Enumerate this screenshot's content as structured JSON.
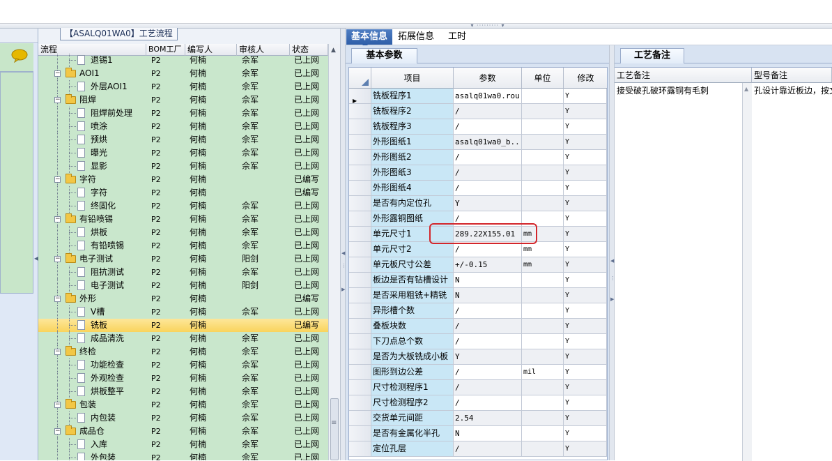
{
  "tree": {
    "title": "【ASALQ01WA0】工艺流程",
    "columns": [
      "流程",
      "BOM工厂",
      "编写人",
      "审核人",
      "状态"
    ],
    "rows": [
      {
        "name": "退锡1",
        "type": "doc",
        "level": 2,
        "bom": "P2",
        "writer": "何楠",
        "checker": "佘军",
        "status": "已上网"
      },
      {
        "name": "AOI1",
        "type": "folder",
        "level": 1,
        "bom": "P2",
        "writer": "何楠",
        "checker": "佘军",
        "status": "已上网"
      },
      {
        "name": "外层AOI1",
        "type": "doc",
        "level": 2,
        "bom": "P2",
        "writer": "何楠",
        "checker": "佘军",
        "status": "已上网"
      },
      {
        "name": "阻焊",
        "type": "folder",
        "level": 1,
        "bom": "P2",
        "writer": "何楠",
        "checker": "佘军",
        "status": "已上网"
      },
      {
        "name": "阻焊前处理",
        "type": "doc",
        "level": 2,
        "bom": "P2",
        "writer": "何楠",
        "checker": "佘军",
        "status": "已上网"
      },
      {
        "name": "喷涂",
        "type": "doc",
        "level": 2,
        "bom": "P2",
        "writer": "何楠",
        "checker": "佘军",
        "status": "已上网"
      },
      {
        "name": "预烘",
        "type": "doc",
        "level": 2,
        "bom": "P2",
        "writer": "何楠",
        "checker": "佘军",
        "status": "已上网"
      },
      {
        "name": "曝光",
        "type": "doc",
        "level": 2,
        "bom": "P2",
        "writer": "何楠",
        "checker": "佘军",
        "status": "已上网"
      },
      {
        "name": "显影",
        "type": "doc",
        "level": 2,
        "bom": "P2",
        "writer": "何楠",
        "checker": "佘军",
        "status": "已上网"
      },
      {
        "name": "字符",
        "type": "folder",
        "level": 1,
        "bom": "P2",
        "writer": "何楠",
        "checker": "",
        "status": "已编写"
      },
      {
        "name": "字符",
        "type": "doc",
        "level": 2,
        "bom": "P2",
        "writer": "何楠",
        "checker": "",
        "status": "已编写"
      },
      {
        "name": "终固化",
        "type": "doc",
        "level": 2,
        "bom": "P2",
        "writer": "何楠",
        "checker": "佘军",
        "status": "已上网"
      },
      {
        "name": "有铅喷锡",
        "type": "folder",
        "level": 1,
        "bom": "P2",
        "writer": "何楠",
        "checker": "佘军",
        "status": "已上网"
      },
      {
        "name": "烘板",
        "type": "doc",
        "level": 2,
        "bom": "P2",
        "writer": "何楠",
        "checker": "佘军",
        "status": "已上网"
      },
      {
        "name": "有铅喷锡",
        "type": "doc",
        "level": 2,
        "bom": "P2",
        "writer": "何楠",
        "checker": "佘军",
        "status": "已上网"
      },
      {
        "name": "电子测试",
        "type": "folder",
        "level": 1,
        "bom": "P2",
        "writer": "何楠",
        "checker": "阳剑",
        "status": "已上网"
      },
      {
        "name": "阻抗测试",
        "type": "doc",
        "level": 2,
        "bom": "P2",
        "writer": "何楠",
        "checker": "佘军",
        "status": "已上网"
      },
      {
        "name": "电子测试",
        "type": "doc",
        "level": 2,
        "bom": "P2",
        "writer": "何楠",
        "checker": "阳剑",
        "status": "已上网"
      },
      {
        "name": "外形",
        "type": "folder",
        "level": 1,
        "bom": "P2",
        "writer": "何楠",
        "checker": "",
        "status": "已编写"
      },
      {
        "name": "V槽",
        "type": "doc",
        "level": 2,
        "bom": "P2",
        "writer": "何楠",
        "checker": "佘军",
        "status": "已上网"
      },
      {
        "name": "铣板",
        "type": "doc",
        "level": 2,
        "bom": "P2",
        "writer": "何楠",
        "checker": "",
        "status": "已编写",
        "selected": true
      },
      {
        "name": "成品清洗",
        "type": "doc",
        "level": 2,
        "bom": "P2",
        "writer": "何楠",
        "checker": "佘军",
        "status": "已上网"
      },
      {
        "name": "终检",
        "type": "folder",
        "level": 1,
        "bom": "P2",
        "writer": "何楠",
        "checker": "佘军",
        "status": "已上网"
      },
      {
        "name": "功能检查",
        "type": "doc",
        "level": 2,
        "bom": "P2",
        "writer": "何楠",
        "checker": "佘军",
        "status": "已上网"
      },
      {
        "name": "外观检查",
        "type": "doc",
        "level": 2,
        "bom": "P2",
        "writer": "何楠",
        "checker": "佘军",
        "status": "已上网"
      },
      {
        "name": "烘板整平",
        "type": "doc",
        "level": 2,
        "bom": "P2",
        "writer": "何楠",
        "checker": "佘军",
        "status": "已上网"
      },
      {
        "name": "包装",
        "type": "folder",
        "level": 1,
        "bom": "P2",
        "writer": "何楠",
        "checker": "佘军",
        "status": "已上网"
      },
      {
        "name": "内包装",
        "type": "doc",
        "level": 2,
        "bom": "P2",
        "writer": "何楠",
        "checker": "佘军",
        "status": "已上网"
      },
      {
        "name": "成品仓",
        "type": "folder",
        "level": 1,
        "bom": "P2",
        "writer": "何楠",
        "checker": "佘军",
        "status": "已上网"
      },
      {
        "name": "入库",
        "type": "doc",
        "level": 2,
        "bom": "P2",
        "writer": "何楠",
        "checker": "佘军",
        "status": "已上网"
      },
      {
        "name": "外包装",
        "type": "doc",
        "level": 2,
        "bom": "P2",
        "writer": "何楠",
        "checker": "佘军",
        "status": "已上网"
      }
    ]
  },
  "tabs": [
    "基本信息",
    "拓展信息",
    "工时"
  ],
  "params_panel": {
    "tab_label": "基本参数",
    "columns": [
      "项目",
      "参数",
      "单位",
      "修改"
    ],
    "rows": [
      {
        "item": "铣板程序1",
        "param": "asalq01wa0.rou",
        "unit": "",
        "mod": "Y",
        "current": true
      },
      {
        "item": "铣板程序2",
        "param": "/",
        "unit": "",
        "mod": "Y"
      },
      {
        "item": "铣板程序3",
        "param": "/",
        "unit": "",
        "mod": "Y"
      },
      {
        "item": "外形图纸1",
        "param": "asalq01wa0_b...",
        "unit": "",
        "mod": "Y"
      },
      {
        "item": "外形图纸2",
        "param": "/",
        "unit": "",
        "mod": "Y"
      },
      {
        "item": "外形图纸3",
        "param": "/",
        "unit": "",
        "mod": "Y"
      },
      {
        "item": "外形图纸4",
        "param": "/",
        "unit": "",
        "mod": "Y"
      },
      {
        "item": "是否有内定位孔",
        "param": "Y",
        "unit": "",
        "mod": "Y"
      },
      {
        "item": "外形露铜图纸",
        "param": "/",
        "unit": "",
        "mod": "Y"
      },
      {
        "item": "单元尺寸1",
        "param": "289.22X155.01",
        "unit": "mm",
        "mod": "Y",
        "highlighted": true
      },
      {
        "item": "单元尺寸2",
        "param": "/",
        "unit": "mm",
        "mod": "Y"
      },
      {
        "item": "单元板尺寸公差",
        "param": "+/-0.15",
        "unit": "mm",
        "mod": "Y"
      },
      {
        "item": "板边是否有钻槽设计",
        "param": "N",
        "unit": "",
        "mod": "Y"
      },
      {
        "item": "是否采用粗铣+精铣",
        "param": "N",
        "unit": "",
        "mod": "Y"
      },
      {
        "item": "异形槽个数",
        "param": "/",
        "unit": "",
        "mod": "Y"
      },
      {
        "item": "叠板块数",
        "param": "/",
        "unit": "",
        "mod": "Y"
      },
      {
        "item": "下刀点总个数",
        "param": "/",
        "unit": "",
        "mod": "Y"
      },
      {
        "item": "是否为大板铣成小板",
        "param": "Y",
        "unit": "",
        "mod": "Y"
      },
      {
        "item": "图形到边公差",
        "param": "/",
        "unit": "mil",
        "mod": "Y"
      },
      {
        "item": "尺寸检测程序1",
        "param": "/",
        "unit": "",
        "mod": "Y"
      },
      {
        "item": "尺寸检测程序2",
        "param": "/",
        "unit": "",
        "mod": "Y"
      },
      {
        "item": "交货单元间距",
        "param": "2.54",
        "unit": "",
        "mod": "Y"
      },
      {
        "item": "是否有金属化半孔",
        "param": "N",
        "unit": "",
        "mod": "Y"
      },
      {
        "item": "定位孔层",
        "param": "/",
        "unit": "",
        "mod": "Y"
      }
    ]
  },
  "notes_panel": {
    "tab_label": "工艺备注",
    "columns": [
      "工艺备注",
      "型号备注"
    ],
    "process_note": "接受破孔破环露铜有毛刺",
    "model_note": "孔设计靠近板边，按文"
  }
}
